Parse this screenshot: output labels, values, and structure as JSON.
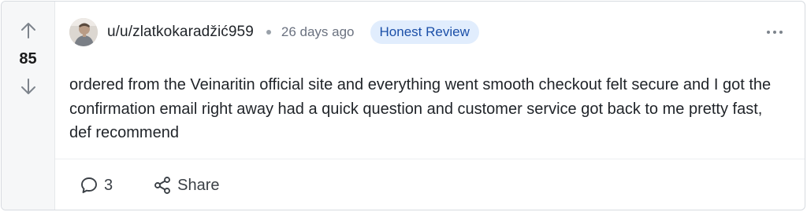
{
  "post": {
    "vote_count": "85",
    "author": "u/u/zlatkokaradžić959",
    "timestamp": "26 days ago",
    "flair": "Honest Review",
    "body": "ordered from the Veinaritin official site and everything went smooth checkout felt secure and I got the confirmation email right away had a quick question and customer service got back to me pretty fast, def recommend",
    "comment_count": "3",
    "share_label": "Share"
  },
  "icons": {
    "upvote": "arrow-up-icon",
    "downvote": "arrow-down-icon",
    "more": "more-horizontal-icon",
    "comment": "comment-bubble-icon",
    "share": "share-nodes-icon"
  },
  "colors": {
    "flair_bg": "#e1edfd",
    "flair_text": "#1b4fa8",
    "rail_bg": "#f6f7f8"
  }
}
